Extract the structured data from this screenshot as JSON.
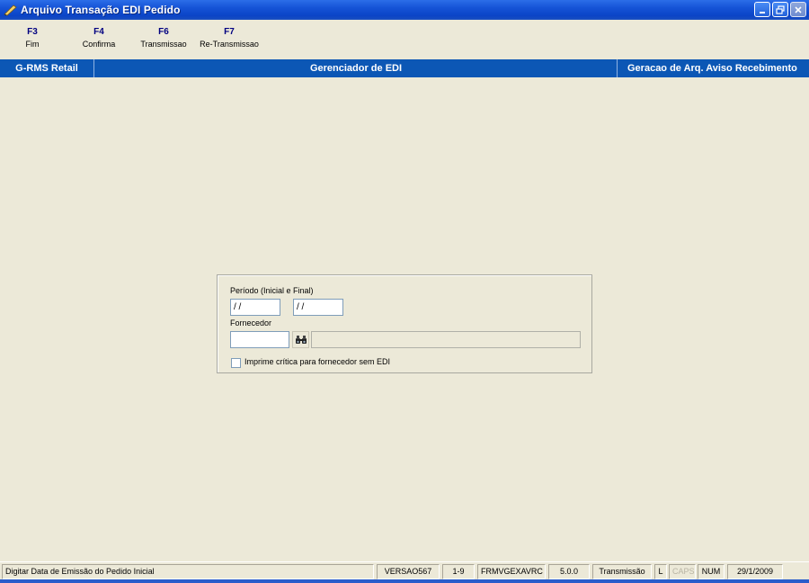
{
  "window": {
    "title": "Arquivo Transação EDI Pedido",
    "app_icon": "pen-icon",
    "controls": [
      "minimize-icon",
      "restore-icon",
      "close-icon"
    ]
  },
  "toolbar": {
    "keys": [
      {
        "key": "F3",
        "label": "Fim"
      },
      {
        "key": "F4",
        "label": "Confirma"
      },
      {
        "key": "F6",
        "label": "Transmissao"
      },
      {
        "key": "F7",
        "label": "Re-Transmissao"
      }
    ]
  },
  "header": {
    "left": "G-RMS Retail",
    "center": "Gerenciador de EDI",
    "right": "Geracao de Arq. Aviso Recebimento"
  },
  "form": {
    "period_label": "Período (Inicial e Final)",
    "date_start": " / /",
    "date_end": " / /",
    "supplier_label": "Fornecedor",
    "supplier_code": "",
    "supplier_name": "",
    "search_icon": "binoculars-icon",
    "checkbox_label": "Imprime crítica para fornecedor sem EDI",
    "checkbox_checked": false
  },
  "statusbar": {
    "message": "Digitar Data de Emissão do Pedido Inicial",
    "version": "VERSAO567",
    "range": "1-9",
    "form_name": "FRMVGEXAVRC",
    "build": "5.0.0",
    "mode": "Transmissão",
    "l": "L",
    "caps": "CAPS",
    "num": "NUM",
    "date": "29/1/2009"
  },
  "colors": {
    "titlebar": "#1553d6",
    "header_bar": "#0c57b5",
    "background": "#ece9d8",
    "fkey_text": "#000080"
  }
}
